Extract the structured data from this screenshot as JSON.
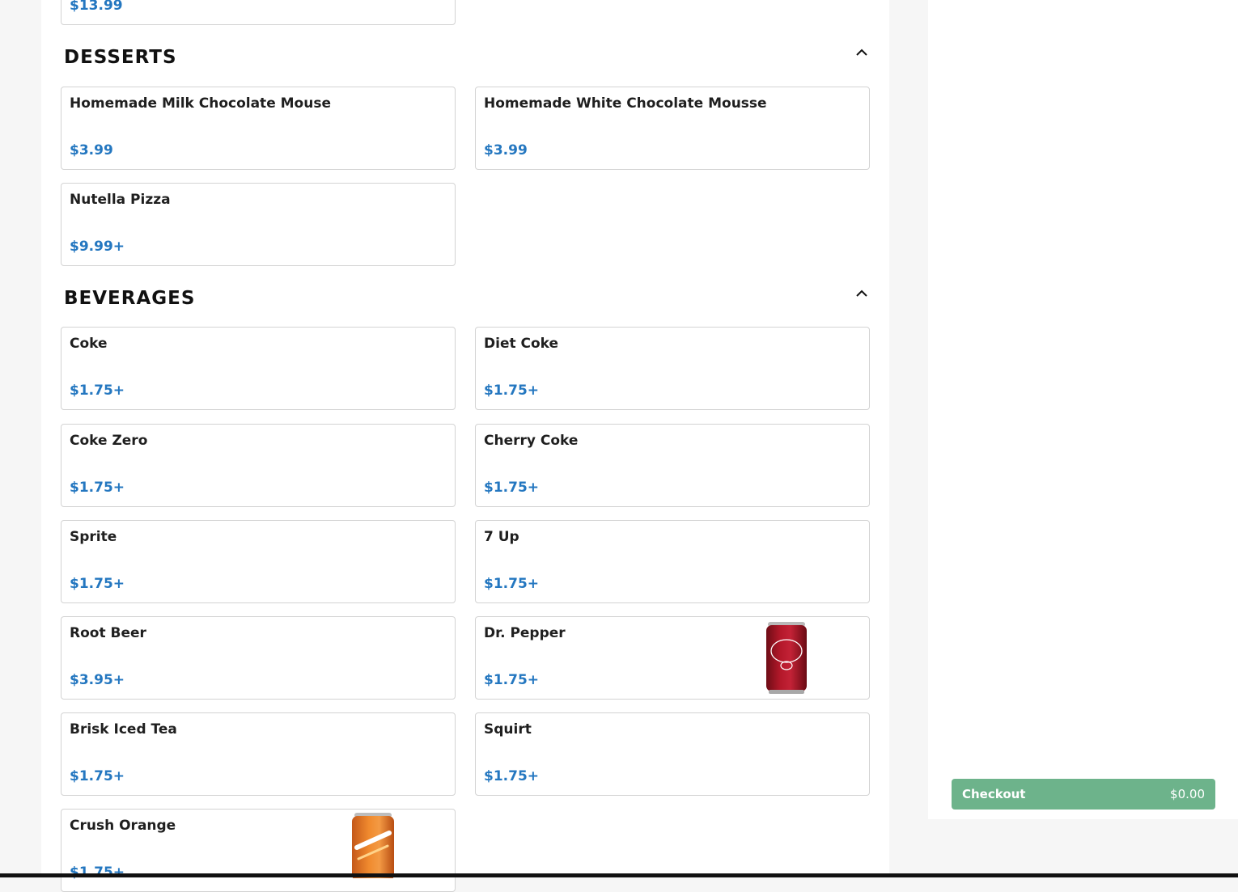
{
  "sections": [
    {
      "title": "DESSERTS",
      "items": [
        {
          "name": "Homemade Milk Chocolate Mouse",
          "price": "$3.99"
        },
        {
          "name": "Homemade White Chocolate Mousse",
          "price": "$3.99"
        },
        {
          "name": "Nutella Pizza",
          "price": "$9.99+"
        }
      ]
    },
    {
      "title": "BEVERAGES",
      "items": [
        {
          "name": "Coke",
          "price": "$1.75+"
        },
        {
          "name": "Diet Coke",
          "price": "$1.75+"
        },
        {
          "name": "Coke Zero",
          "price": "$1.75+"
        },
        {
          "name": "Cherry Coke",
          "price": "$1.75+"
        },
        {
          "name": "Sprite",
          "price": "$1.75+"
        },
        {
          "name": "7 Up",
          "price": "$1.75+"
        },
        {
          "name": "Root Beer",
          "price": "$3.95+"
        },
        {
          "name": "Dr. Pepper",
          "price": "$1.75+",
          "image": "dr-pepper-can"
        },
        {
          "name": "Brisk Iced Tea",
          "price": "$1.75+"
        },
        {
          "name": "Squirt",
          "price": "$1.75+"
        },
        {
          "name": "Crush Orange",
          "price": "$1.75+",
          "image": "crush-orange-can"
        }
      ]
    }
  ],
  "previous_item": {
    "price": "$13.99"
  },
  "checkout": {
    "label": "Checkout",
    "total": "$0.00"
  },
  "colors": {
    "price": "#2477c0",
    "checkout": "#6db38b"
  },
  "icons": {
    "section_toggle": "chevron-up-icon"
  }
}
